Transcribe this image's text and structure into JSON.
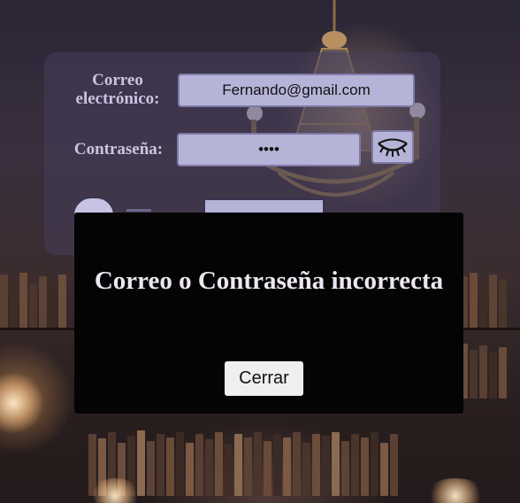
{
  "form": {
    "email_label": "Correo electrónico:",
    "email_value": "Fernando@gmail.com",
    "password_label": "Contraseña:",
    "password_value": "••••",
    "show_password_icon": "closed-eye-icon",
    "remember_toggle": {
      "on": false
    }
  },
  "modal": {
    "message": "Correo o Contraseña incorrecta",
    "close_label": "Cerrar"
  },
  "colors": {
    "card": "#463e5a",
    "field": "#b6b3d8",
    "label": "#c9c5e2",
    "modal": "#050405"
  }
}
